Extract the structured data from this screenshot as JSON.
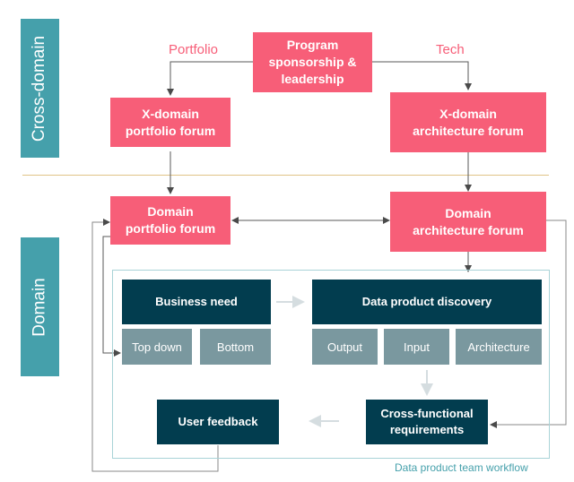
{
  "sections": {
    "cross_domain": "Cross-domain",
    "domain": "Domain"
  },
  "edge_labels": {
    "portfolio": "Portfolio",
    "tech": "Tech"
  },
  "nodes": {
    "program": "Program sponsorship & leadership",
    "xdomain_portfolio": "X-domain portfolio forum",
    "xdomain_architecture": "X-domain architecture forum",
    "domain_portfolio": "Domain portfolio forum",
    "domain_architecture": "Domain architecture forum"
  },
  "workflow": {
    "label": "Data product team workflow",
    "business_need": "Business need",
    "business_need_sub": [
      "Top down",
      "Bottom"
    ],
    "discovery": "Data product discovery",
    "discovery_sub": [
      "Output",
      "Input",
      "Architecture"
    ],
    "cross_functional": "Cross-functional requirements",
    "user_feedback": "User feedback"
  },
  "colors": {
    "forum": "#f75e78",
    "workflow_step": "#023d4f",
    "sub_step": "#7a989f",
    "section_label": "#45a0ab",
    "divider": "#e0c487"
  }
}
